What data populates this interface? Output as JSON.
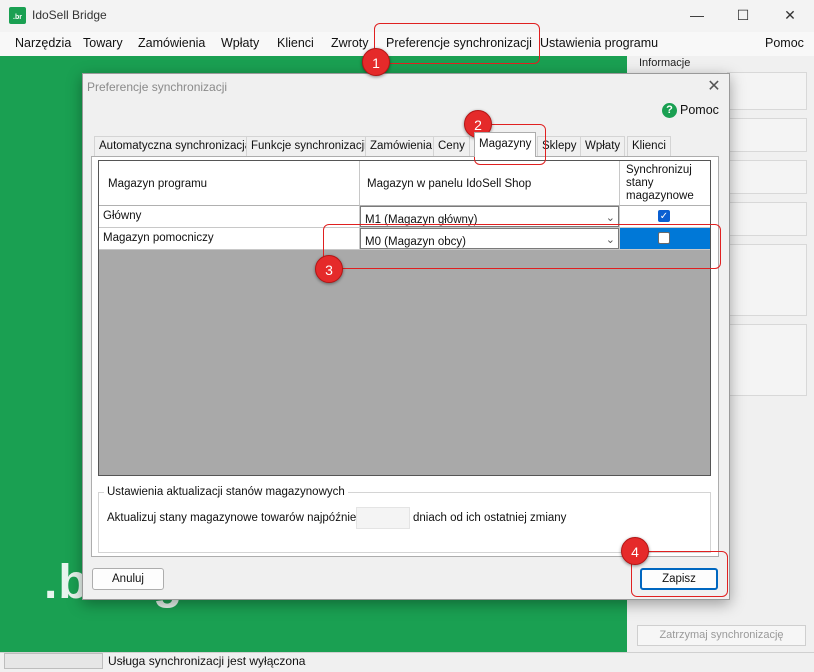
{
  "window": {
    "title": "IdoSell Bridge",
    "icon_text": ".br",
    "controls": {
      "minimize": "—",
      "maximize": "☐",
      "close": "✕"
    }
  },
  "menu": {
    "items": [
      "Narzędzia",
      "Towary",
      "Zamówienia",
      "Wpłaty",
      "Klienci",
      "Zwroty",
      "Preferencje synchronizacji",
      "Ustawienia programu"
    ],
    "help": "Pomoc"
  },
  "side_panel": {
    "info_label": "Informacje",
    "stop_sync_button": "Zatrzymaj synchronizację"
  },
  "brand_text": ".bridge",
  "status": {
    "text": "Usługa synchronizacji jest wyłączona"
  },
  "dialog": {
    "title": "Preferencje synchronizacji",
    "close": "✕",
    "help_icon": "?",
    "help_label": "Pomoc",
    "tabs": [
      "Automatyczna synchronizacja",
      "Funkcje synchronizacji",
      "Zamówienia",
      "Ceny",
      "Magazyny",
      "Sklepy",
      "Wpłaty",
      "Klienci"
    ],
    "active_tab": "Magazyny",
    "grid": {
      "headers": {
        "program": "Magazyn programu",
        "shop": "Magazyn w panelu IdoSell Shop",
        "sync_line1": "Synchronizuj",
        "sync_line2": "stany",
        "sync_line3": "magazynowe"
      },
      "rows": [
        {
          "program": "Główny",
          "shop": "M1 (Magazyn główny)",
          "sync": true
        },
        {
          "program": "Magazyn pomocniczy",
          "shop": "M0 (Magazyn obcy)",
          "sync": false
        }
      ]
    },
    "group": {
      "title": "Ustawienia aktualizacji stanów magazynowych",
      "text_before": "Aktualizuj stany magazynowe towarów najpóźniej po",
      "text_after": "dniach od ich ostatniej zmiany"
    },
    "cancel_button": "Anuluj",
    "save_button": "Zapisz"
  },
  "annotations": [
    "1",
    "2",
    "3",
    "4"
  ],
  "colors": {
    "brand_green": "#1aa052",
    "annotation_red": "#e52a2a",
    "selection_blue": "#0078d7"
  }
}
